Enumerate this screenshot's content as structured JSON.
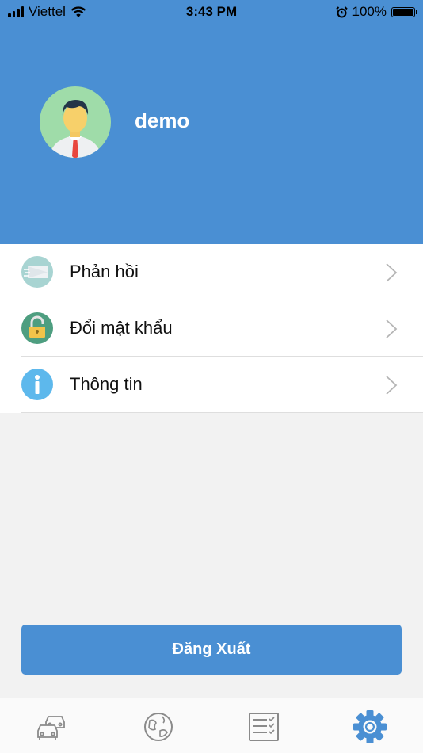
{
  "status_bar": {
    "carrier": "Viettel",
    "time": "3:43 PM",
    "battery": "100%",
    "icons": [
      "signal-bars-icon",
      "wifi-icon",
      "alarm-clock-icon",
      "battery-icon"
    ]
  },
  "profile": {
    "username": "demo",
    "avatar_icon": "user-avatar-icon"
  },
  "menu": [
    {
      "label": "Phản hồi",
      "icon": "feedback-envelope-icon"
    },
    {
      "label": "Đổi mật khẩu",
      "icon": "padlock-icon"
    },
    {
      "label": "Thông tin",
      "icon": "info-icon"
    }
  ],
  "logout": {
    "label": "Đăng Xuất"
  },
  "tabbar": {
    "tabs": [
      {
        "icon": "cars-icon",
        "active": false
      },
      {
        "icon": "globe-icon",
        "active": false
      },
      {
        "icon": "checklist-icon",
        "active": false
      },
      {
        "icon": "settings-gear-icon",
        "active": true
      }
    ]
  },
  "colors": {
    "primary": "#4a8fd3",
    "background": "#f2f2f2",
    "tab_inactive": "#8a8a8a"
  }
}
